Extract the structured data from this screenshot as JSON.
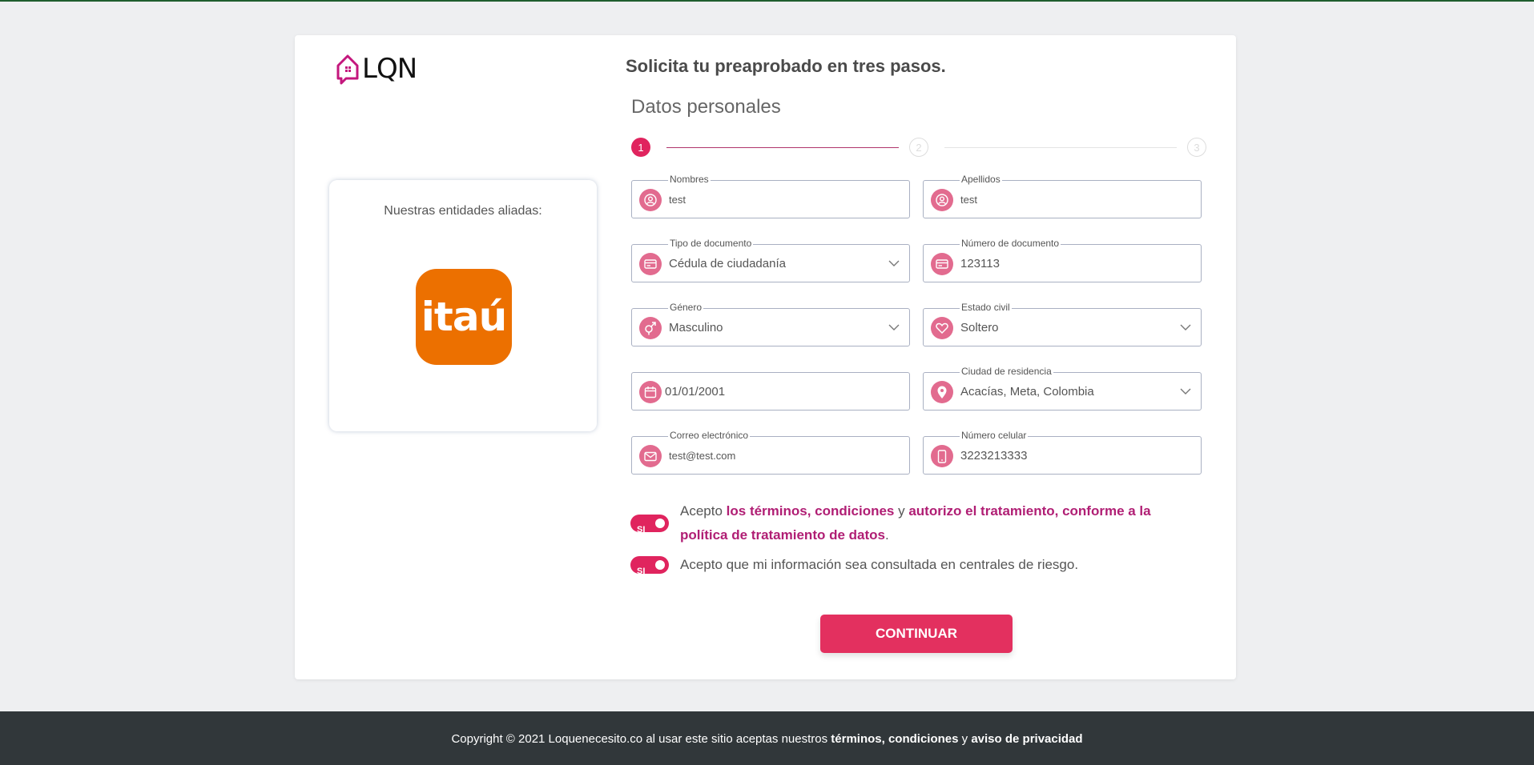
{
  "brand": {
    "name": "LQN",
    "accent": "#e0245e"
  },
  "headline": "Solicita tu preaprobado en tres pasos.",
  "section_title": "Datos personales",
  "steps": [
    "1",
    "2",
    "3"
  ],
  "allies": {
    "title": "Nuestras entidades aliadas:",
    "bank": "itaú"
  },
  "fields": {
    "nombres": {
      "label": "Nombres",
      "value": "test",
      "icon": "user-circle-icon"
    },
    "apellidos": {
      "label": "Apellidos",
      "value": "test",
      "icon": "user-circle-icon"
    },
    "tipo_documento": {
      "label": "Tipo de documento",
      "value": "Cédula de ciudadanía",
      "icon": "id-card-icon"
    },
    "numero_documento": {
      "label": "Número de documento",
      "value": "123113",
      "icon": "id-card-icon"
    },
    "genero": {
      "label": "Género",
      "value": "Masculino",
      "icon": "gender-icon"
    },
    "estado_civil": {
      "label": "Estado civil",
      "value": "Soltero",
      "icon": "heart-icon"
    },
    "fecha": {
      "value": "01/01/2001",
      "icon": "calendar-icon"
    },
    "ciudad": {
      "label": "Ciudad de residencia",
      "value": "Acacías, Meta, Colombia",
      "icon": "map-pin-icon"
    },
    "correo": {
      "label": "Correo electrónico",
      "value": "test@test.com",
      "icon": "mail-icon"
    },
    "celular": {
      "label": "Número celular",
      "value": "3223213333",
      "icon": "phone-icon"
    }
  },
  "consents": {
    "toggle_label": "SI",
    "terms": {
      "prefix": "Acepto ",
      "link1": "los términos, condiciones",
      "mid": " y ",
      "link2": "autorizo el tratamiento, conforme a la política de tratamiento de datos",
      "suffix": "."
    },
    "risk": "Acepto que mi información sea consultada en centrales de riesgo."
  },
  "continue_label": "CONTINUAR",
  "footer": {
    "prefix": "Copyright © 2021 Loquenecesito.co al usar este sitio aceptas nuestros ",
    "bold1": "términos, condiciones",
    "mid": " y ",
    "bold2": "aviso de privacidad"
  }
}
